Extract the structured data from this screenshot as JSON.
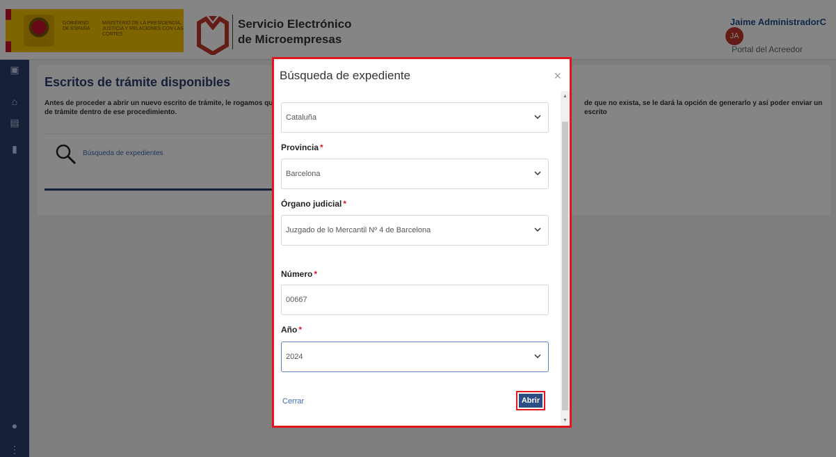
{
  "header": {
    "gov_label": "GOBIERNO DE ESPAÑA",
    "ministry_label": "MINISTERIO DE LA PRESIDENCIA, JUSTICIA Y RELACIONES CON LAS CORTES",
    "app_title_line1": "Servicio Electrónico",
    "app_title_line2": "de Microempresas",
    "user_name": "Jaime AdministradorC",
    "user_initials": "JA",
    "user_role": "Portal del Acreedor"
  },
  "page": {
    "title": "Escritos de trámite disponibles",
    "description": "Antes de proceder a abrir un nuevo escrito de trámite, le rogamos que ve… de que no exista, se le dará la opción de generarlo y así poder enviar un escrito de trámite dentro de ese procedimiento.",
    "description_left": "Antes de proceder a abrir un nuevo escrito de trámite, le rogamos que ve",
    "description_right": "de que no exista, se le dará la opción de generarlo y así poder enviar un escrito",
    "description_line2": "de trámite dentro de ese procedimiento.",
    "search_tile_label": "Búsqueda de expedientes"
  },
  "modal": {
    "title": "Búsqueda de expediente",
    "close_label": "×",
    "fields": {
      "comunidad_value": "Cataluña",
      "provincia_label": "Provincia",
      "provincia_value": "Barcelona",
      "organo_label": "Órgano judicial",
      "organo_value": "Juzgado de lo Mercantil Nº 4 de Barcelona",
      "numero_label": "Número",
      "numero_value": "00667",
      "anio_label": "Año",
      "anio_value": "2024",
      "required_mark": "*"
    },
    "cerrar_label": "Cerrar",
    "abrir_label": "Abrir"
  },
  "colors": {
    "accent": "#2d3f6d",
    "highlight": "#e3141b",
    "link": "#3c6bb0"
  }
}
